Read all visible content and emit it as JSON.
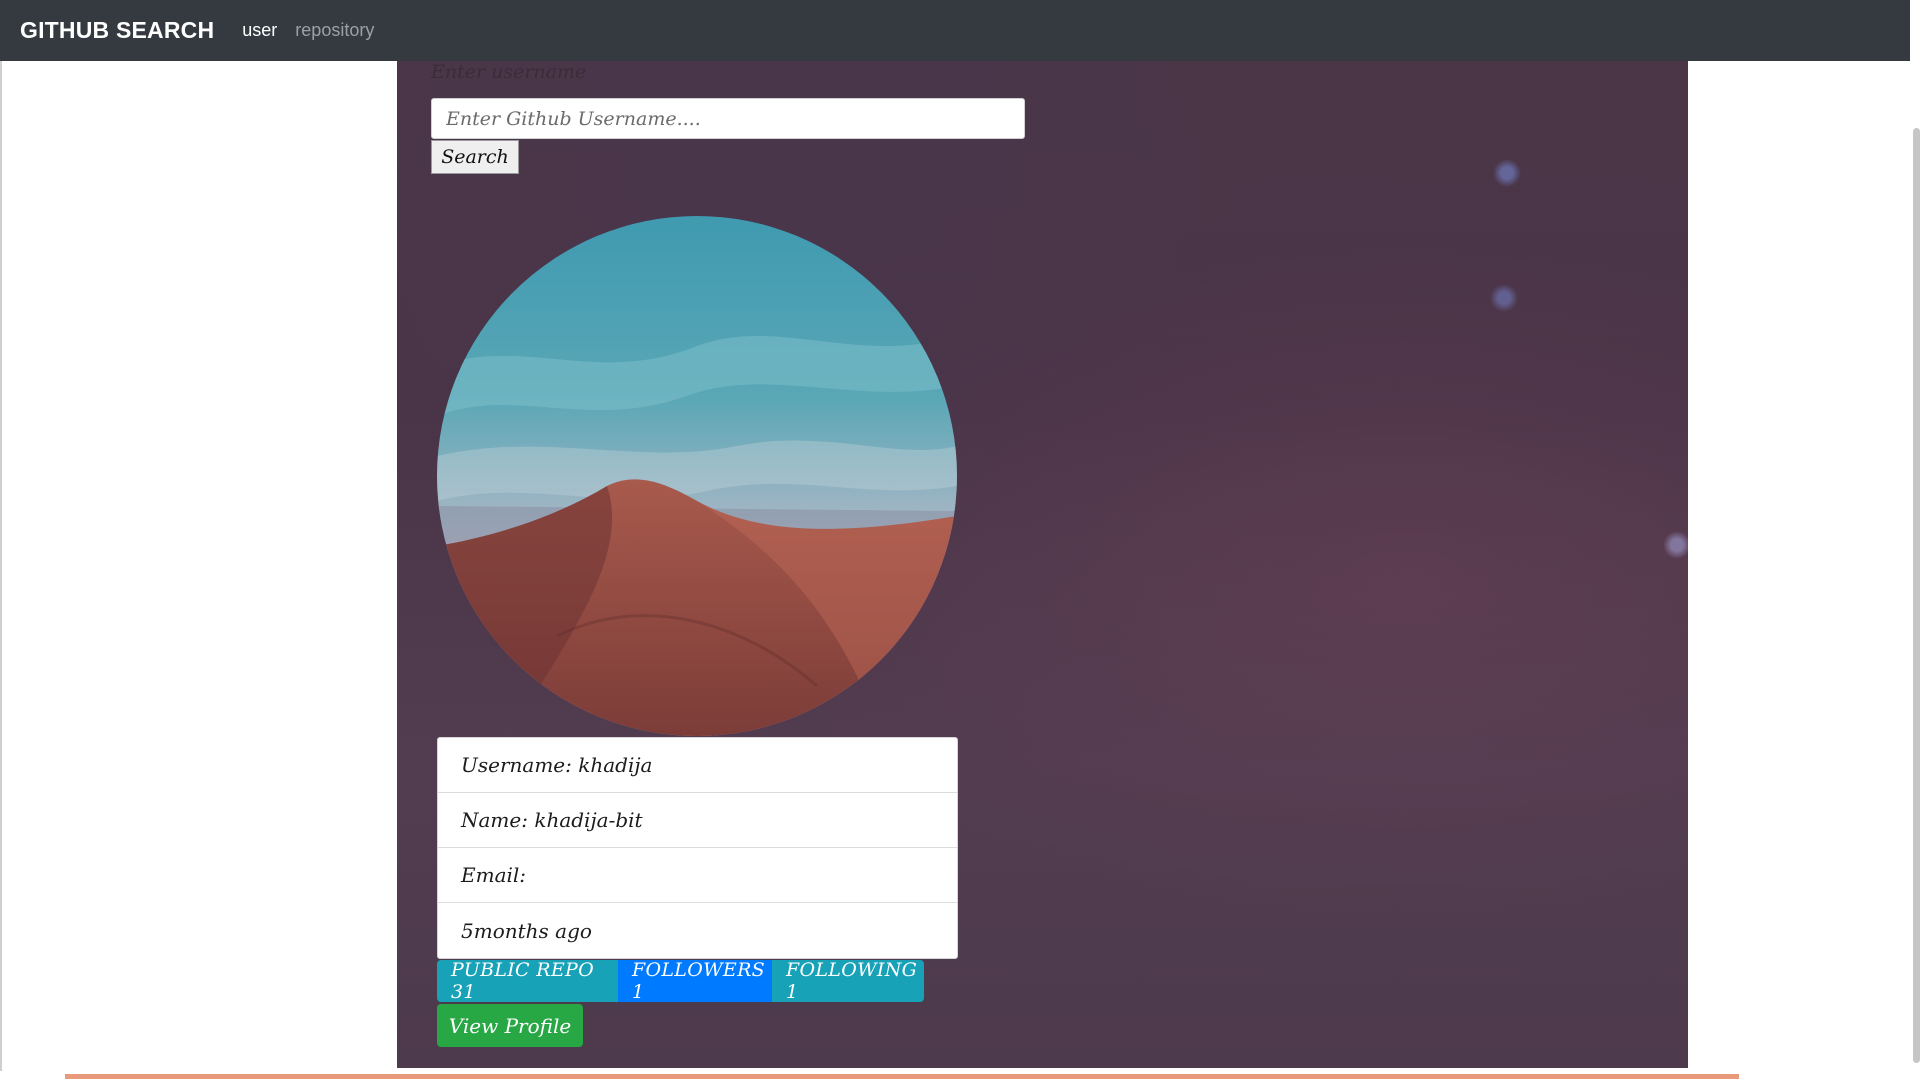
{
  "navbar": {
    "brand": "GITHUB SEARCH",
    "links": [
      "user",
      "repository"
    ]
  },
  "search": {
    "label": "Enter username",
    "placeholder": "Enter Github Username....",
    "value": "",
    "button_label": "Search"
  },
  "profile": {
    "avatar_description": "desert-dunes-avatar",
    "details": [
      "Username: khadija",
      "Name: khadija-bit",
      "Email:",
      "5months ago"
    ],
    "badges": [
      "PUBLIC REPO 31",
      "FOLLOWERS 1",
      "FOLLOWING 1"
    ],
    "view_profile_label": "View Profile"
  },
  "colors": {
    "navbar": "#343a40",
    "info_badge": "#17a2b8",
    "primary_badge": "#007bff",
    "success_button": "#28a745"
  }
}
